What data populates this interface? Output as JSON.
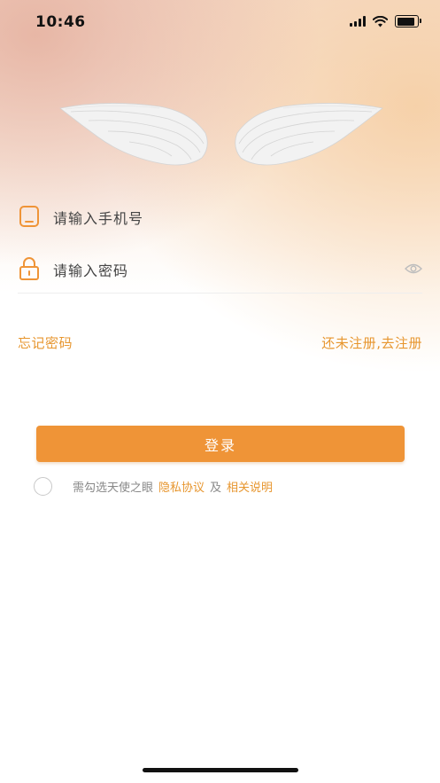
{
  "status_bar": {
    "time": "10:46"
  },
  "form": {
    "phone_placeholder": "请输入手机号",
    "password_placeholder": "请输入密码"
  },
  "links": {
    "forgot_password": "忘记密码",
    "register": "还未注册,去注册"
  },
  "login_button": "登录",
  "agreement": {
    "prefix": "需勾选天使之眼",
    "privacy": "隐私协议",
    "and": "及",
    "related": "相关说明"
  },
  "colors": {
    "accent": "#ef9437",
    "link": "#e7962f"
  },
  "icons": {
    "phone": "phone-icon",
    "lock": "lock-icon",
    "eye": "eye-icon",
    "wings": "angel-wings"
  }
}
